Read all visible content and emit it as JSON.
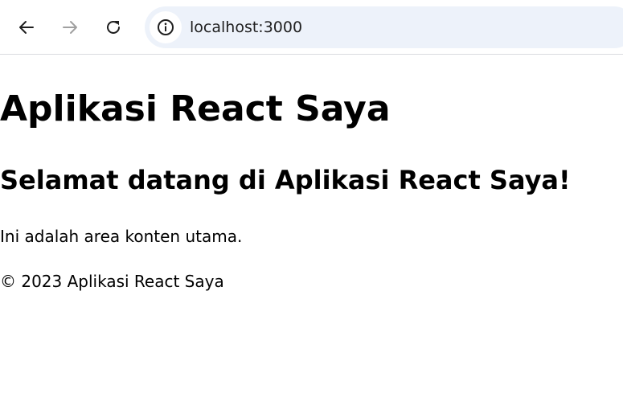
{
  "browser": {
    "url": "localhost:3000",
    "back_icon": "arrow-left-icon",
    "forward_icon": "arrow-right-icon",
    "reload_icon": "reload-icon",
    "site_info_icon": "info-icon",
    "forward_enabled": false
  },
  "page": {
    "title": "Aplikasi React Saya",
    "welcome": "Selamat datang di Aplikasi React Saya!",
    "main_text": "Ini adalah area konten utama.",
    "footer": "© 2023 Aplikasi React Saya"
  },
  "colors": {
    "omnibox_bg": "#edf2fa",
    "icon_active": "#1f1f1f",
    "icon_disabled": "#a0a0a0"
  }
}
